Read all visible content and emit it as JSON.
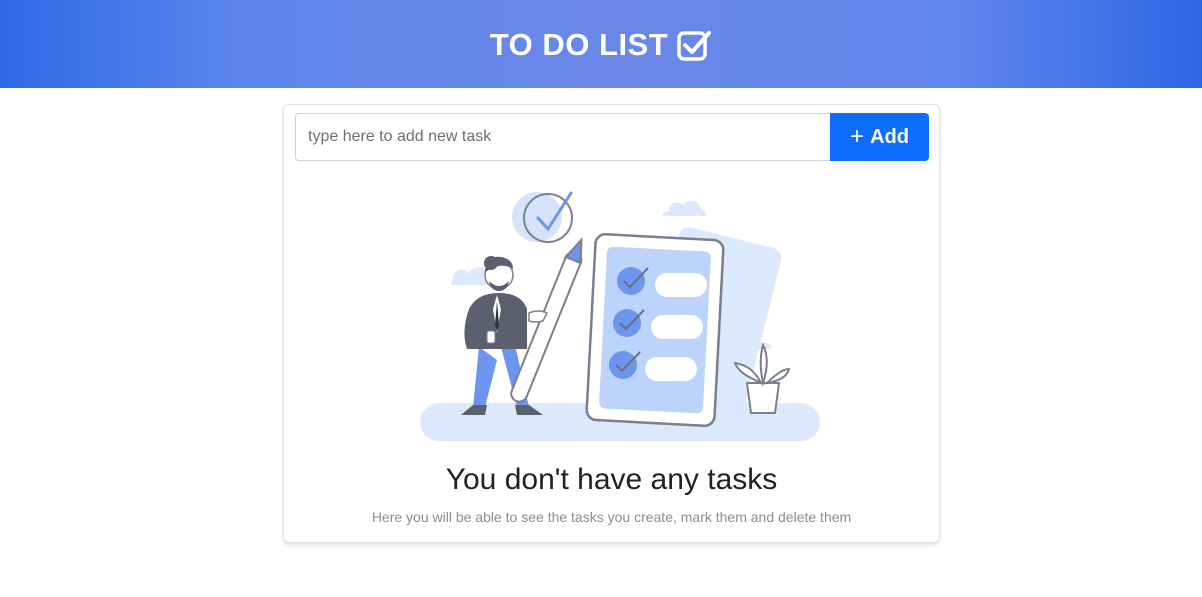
{
  "header": {
    "title": "TO DO LIST",
    "icon": "checkbox-checked-icon"
  },
  "task_form": {
    "placeholder": "type here to add new task",
    "value": "",
    "add_label": "Add",
    "add_icon": "plus-icon"
  },
  "empty_state": {
    "title": "You don't have any tasks",
    "subtitle": "Here you will be able to see the tasks you create, mark them and delete them",
    "illustration": "person-with-pencil-checklist-illustration"
  },
  "colors": {
    "header_gradient_edge": "#2f6ae6",
    "header_gradient_center": "#6b87e8",
    "primary_button": "#0d6efd",
    "illustration_light": "#dce8fb",
    "illustration_mid": "#bcd3fb",
    "illustration_accent": "#6d94ee"
  }
}
